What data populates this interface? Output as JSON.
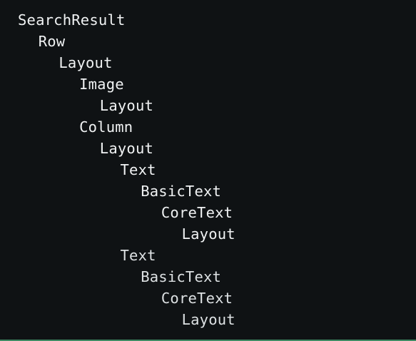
{
  "tree": {
    "nodes": [
      {
        "label": "SearchResult"
      },
      {
        "label": "Row"
      },
      {
        "label": "Layout"
      },
      {
        "label": "Image"
      },
      {
        "label": "Layout"
      },
      {
        "label": "Column"
      },
      {
        "label": "Layout"
      },
      {
        "label": "Text"
      },
      {
        "label": "BasicText"
      },
      {
        "label": "CoreText"
      },
      {
        "label": "Layout"
      },
      {
        "label": "Text"
      },
      {
        "label": "BasicText"
      },
      {
        "label": "CoreText"
      },
      {
        "label": "Layout"
      }
    ]
  },
  "colors": {
    "background": "#0f1214",
    "text": "#f0f2f3",
    "accent_bottom": "#3e8a63"
  }
}
